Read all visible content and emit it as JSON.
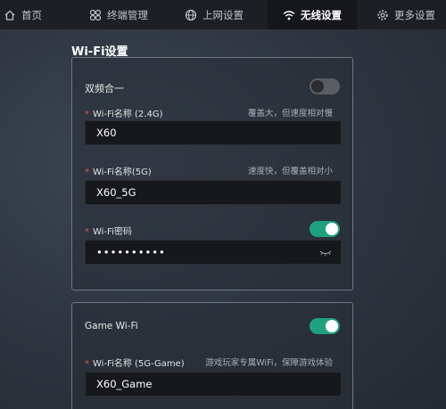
{
  "nav": {
    "home": "首页",
    "devices": "终端管理",
    "internet": "上网设置",
    "wireless": "无线设置",
    "more": "更多设置"
  },
  "wifi_section": {
    "title": "Wi-Fi设置",
    "dual_band": {
      "label": "双频合一",
      "enabled": false
    },
    "ssid_24": {
      "label": "Wi-Fi名称 (2.4G)",
      "hint": "覆盖大，但速度相对慢",
      "value": "X60"
    },
    "ssid_5": {
      "label": "Wi-Fi名称(5G)",
      "hint": "速度快，但覆盖相对小",
      "value": "X60_5G"
    },
    "password": {
      "label": "Wi-Fi密码",
      "value": "••••••••••",
      "toggle_enabled": true
    }
  },
  "game_section": {
    "label": "Game Wi-Fi",
    "enabled": true,
    "ssid_game": {
      "label": "Wi-Fi名称 (5G-Game)",
      "hint": "游戏玩家专属WiFi，保障游戏体验",
      "value": "X60_Game"
    }
  },
  "colors": {
    "toggle_on": "#1fa17f",
    "required_star": "#e25555",
    "nav_bg": "#1d1f24"
  }
}
